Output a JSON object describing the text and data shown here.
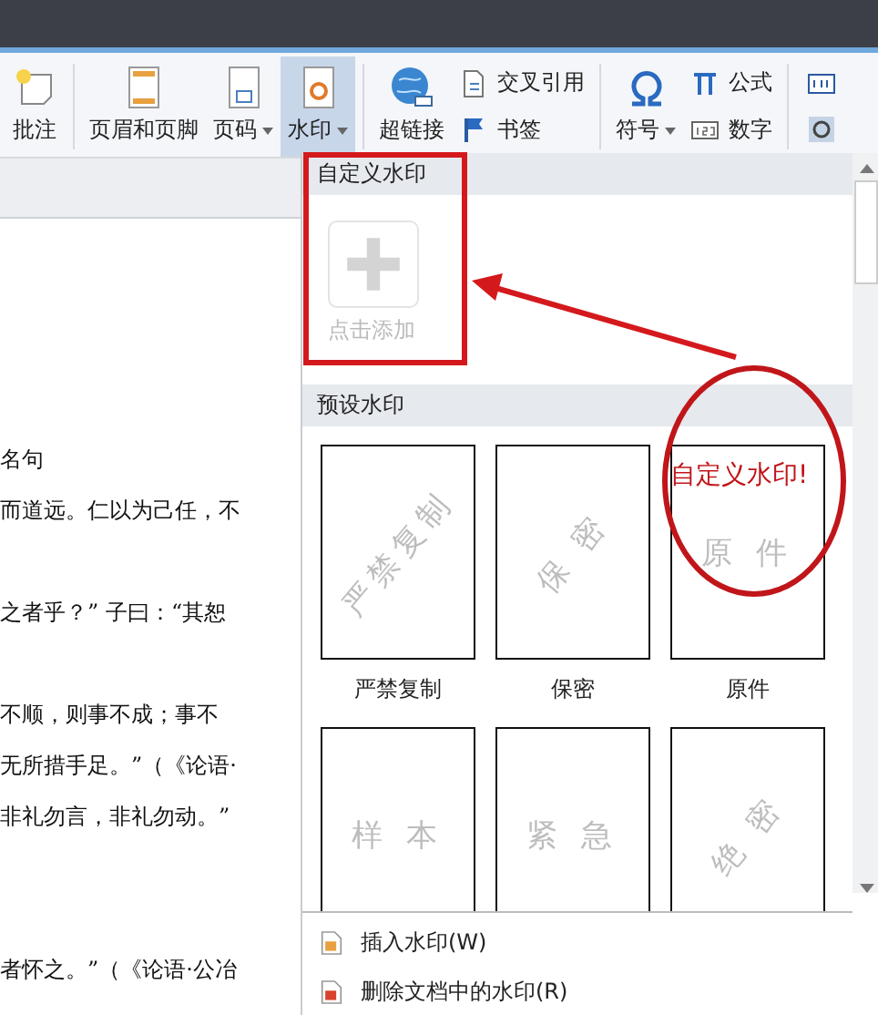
{
  "ribbon_groups": [
    [
      {
        "kind": "large",
        "label": "批注",
        "dropdown": false,
        "selected": false
      }
    ],
    [
      {
        "kind": "large",
        "label": "页眉和页脚",
        "dropdown": false,
        "selected": false
      },
      {
        "kind": "large",
        "label": "页码",
        "dropdown": true,
        "selected": false
      },
      {
        "kind": "large",
        "label": "水印",
        "dropdown": true,
        "selected": true
      }
    ],
    [
      {
        "kind": "large",
        "label": "超链接",
        "dropdown": false,
        "selected": false
      },
      {
        "kind": "stack",
        "items": [
          {
            "label": "交叉引用"
          },
          {
            "label": "书签"
          }
        ]
      }
    ],
    [
      {
        "kind": "large",
        "label": "符号",
        "dropdown": true,
        "selected": false
      },
      {
        "kind": "stack",
        "items": [
          {
            "label": "公式"
          },
          {
            "label": "数字"
          }
        ]
      }
    ],
    [
      {
        "kind": "cut"
      }
    ]
  ],
  "document_paragraphs": [
    [
      "名句",
      "而道远。仁以为己任，不"
    ],
    [
      "之者乎？” 子曰：“其恕"
    ],
    [
      "不顺，则事不成；事不",
      "无所措手足。”（《论语·",
      "非礼勿言，非礼勿动。”"
    ],
    [
      "者怀之。”（《论语·公冶"
    ]
  ],
  "watermark_menu": {
    "custom_section": {
      "title": "自定义水印",
      "add_label": "点击添加"
    },
    "preset_section": {
      "title": "预设水印",
      "presets": [
        {
          "text": "严禁复制",
          "label": "严禁复制",
          "kind": "diagonal"
        },
        {
          "text": "保 密",
          "label": "保密",
          "kind": "diagonal"
        },
        {
          "text": "原 件",
          "label": "原件",
          "kind": "horizontal"
        },
        {
          "text": "样 本",
          "kind": "horizontal"
        },
        {
          "text": "紧 急",
          "kind": "horizontal"
        },
        {
          "text": "绝 密",
          "kind": "diagonal"
        }
      ]
    },
    "actions": [
      {
        "label": "插入水印(W)",
        "kind": "insert"
      },
      {
        "label": "删除文档中的水印(R)",
        "kind": "delete"
      }
    ]
  },
  "annotation": {
    "text": "自定义水印!"
  }
}
